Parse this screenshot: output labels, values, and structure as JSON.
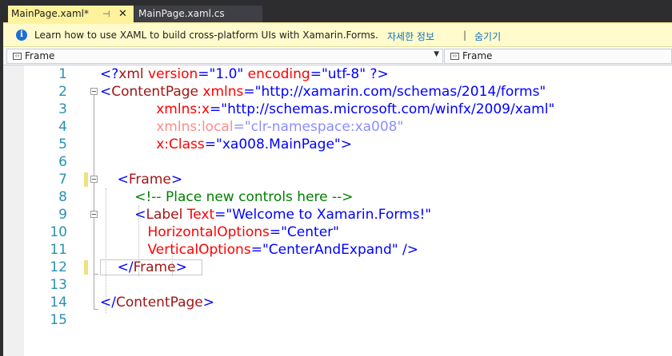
{
  "tabs": [
    {
      "label": "MainPage.xaml*",
      "active": true,
      "pin_icon": "pin-icon",
      "close_icon": "close-icon"
    },
    {
      "label": "MainPage.xaml.cs",
      "active": false
    }
  ],
  "infobar": {
    "icon": "info-icon",
    "icon_glyph": "i",
    "message": "Learn how to use XAML to build cross-platform UIs with Xamarin.Forms.",
    "link_details": "자세한 정보",
    "separator": "|",
    "link_hide": "숨기기"
  },
  "navbar": {
    "left_label": "Frame",
    "right_label": "Frame",
    "element_icon": "xml-element-icon",
    "dropdown_icon": "chevron-down-icon"
  },
  "editor": {
    "line_numbers": [
      "1",
      "2",
      "3",
      "4",
      "5",
      "6",
      "7",
      "8",
      "9",
      "10",
      "11",
      "12",
      "13",
      "14",
      "15"
    ],
    "lines": {
      "l1": {
        "open": "<?",
        "name": "xml",
        "a1": " version",
        "eq1": "=",
        "v1": "\"1.0\"",
        "a2": " encoding",
        "eq2": "=",
        "v2": "\"utf-8\"",
        "close": " ?>"
      },
      "l2": {
        "open": "<",
        "name": "ContentPage",
        "a1": " xmlns",
        "eq1": "=",
        "v1": "\"http://xamarin.com/schemas/2014/forms\""
      },
      "l3": {
        "indent": "             ",
        "a1": "xmlns:x",
        "eq1": "=",
        "v1": "\"http://schemas.microsoft.com/winfx/2009/xaml\""
      },
      "l4": {
        "indent": "             ",
        "a1": "xmlns:local",
        "eq1": "=",
        "v1": "\"clr-namespace:xa008\""
      },
      "l5": {
        "indent": "             ",
        "a1": "x:Class",
        "eq1": "=",
        "v1": "\"xa008.MainPage\"",
        "close": ">"
      },
      "l7": {
        "indent": "    ",
        "open": "<",
        "name": "Frame",
        "close": ">"
      },
      "l8": {
        "indent": "        ",
        "comment": "<!-- Place new controls here -->"
      },
      "l9": {
        "indent": "        ",
        "open": "<",
        "name": "Label",
        "a1": " Text",
        "eq1": "=",
        "v1": "\"Welcome to Xamarin.Forms!\""
      },
      "l10": {
        "indent": "           ",
        "a1": "HorizontalOptions",
        "eq1": "=",
        "v1": "\"Center\""
      },
      "l11": {
        "indent": "           ",
        "a1": "VerticalOptions",
        "eq1": "=",
        "v1": "\"CenterAndExpand\"",
        "close": " />"
      },
      "l12": {
        "indent": "    ",
        "open": "</",
        "name": "Frame",
        "close": ">"
      },
      "l14": {
        "open": "</",
        "name": "ContentPage",
        "close": ">"
      }
    }
  },
  "colors": {
    "active_tab": "#fff29d",
    "delimiter": "#0000ff",
    "element": "#a31515",
    "attribute": "#ff0000",
    "string": "#0000ff",
    "comment": "#008000",
    "line_number": "#2b91af",
    "modified_marker": "#efe27a"
  }
}
